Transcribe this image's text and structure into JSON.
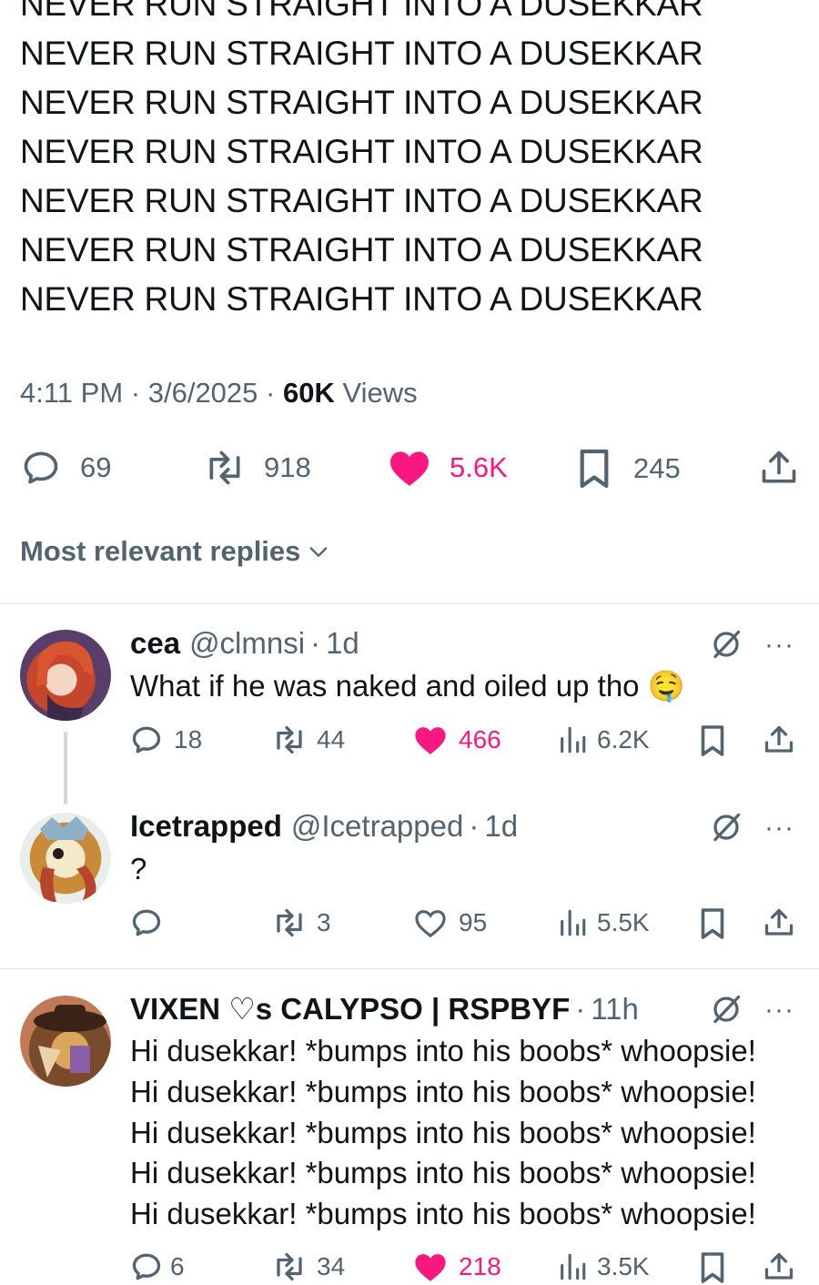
{
  "tweet": {
    "lines": [
      "NEVER RUN STRAIGHT INTO A DUSEKKAR",
      "NEVER RUN STRAIGHT INTO A DUSEKKAR",
      "NEVER RUN STRAIGHT INTO A DUSEKKAR",
      "NEVER RUN STRAIGHT INTO A DUSEKKAR",
      "NEVER RUN STRAIGHT INTO A DUSEKKAR",
      "NEVER RUN STRAIGHT INTO A DUSEKKAR",
      "NEVER RUN STRAIGHT INTO A DUSEKKAR"
    ],
    "time": "4:11 PM",
    "date": "3/6/2025",
    "views_count": "60K",
    "views_label": "Views",
    "replies": "69",
    "reposts": "918",
    "likes": "5.6K",
    "bookmarks": "245"
  },
  "sort_label": "Most relevant replies",
  "replies": [
    {
      "name": "cea",
      "handle": "@clmnsi",
      "age": "1d",
      "text": "What if he was naked and oiled up tho",
      "emoji": "🤤",
      "replies": "18",
      "reposts": "44",
      "likes": "466",
      "liked": true,
      "views": "6.2K"
    },
    {
      "name": "Icetrapped",
      "handle": "@Icetrapped",
      "age": "1d",
      "text": "?",
      "replies": "",
      "reposts": "3",
      "likes": "95",
      "liked": false,
      "views": "5.5K"
    },
    {
      "name": "VIXEN ♡s CALYPSO | RSPBYF",
      "handle": "",
      "age": "11h",
      "lines": [
        "Hi dusekkar! *bumps into his boobs* whoopsie!",
        "Hi dusekkar! *bumps into his boobs* whoopsie!",
        "Hi dusekkar! *bumps into his boobs* whoopsie!",
        "Hi dusekkar! *bumps into his boobs* whoopsie!",
        "Hi dusekkar! *bumps into his boobs* whoopsie!"
      ],
      "replies": "6",
      "reposts": "34",
      "likes": "218",
      "liked": true,
      "views": "3.5K"
    }
  ],
  "dot": "·",
  "more": "···",
  "colors": {
    "like": "#f91880",
    "secondary": "#536471",
    "text": "#0f1419",
    "border": "#dfe3e6"
  },
  "icons": [
    "reply-icon",
    "repost-icon",
    "heart-icon",
    "bookmark-icon",
    "share-icon",
    "views-icon",
    "grok-icon",
    "chevron-down-icon",
    "more-icon"
  ]
}
